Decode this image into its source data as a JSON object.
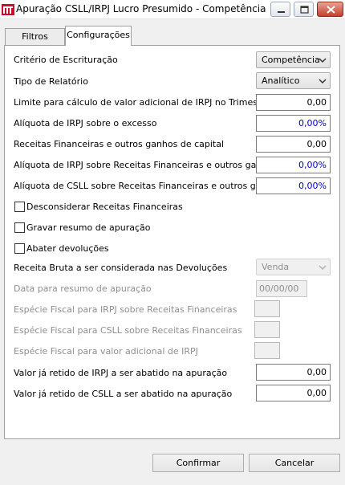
{
  "window": {
    "title": "Apuração CSLL/IRPJ Lucro Presumido - Competência",
    "icon": "app-logo-icon"
  },
  "tabs": [
    {
      "label": "Filtros",
      "active": false
    },
    {
      "label": "Configurações",
      "active": true
    }
  ],
  "form": {
    "criterio_label": "Critério de Escrituração",
    "criterio_value": "Competência",
    "tipo_label": "Tipo de Relatório",
    "tipo_value": "Analítico",
    "limite_label": "Limite para cálculo de valor adicional de IRPJ no Trimestre",
    "limite_value": "0,00",
    "aliq_irpj_label": "Alíquota de IRPJ sobre o excesso",
    "aliq_irpj_value": "0,00%",
    "receitas_label": "Receitas Financeiras e outros ganhos de capital",
    "receitas_value": "0,00",
    "aliq_irpj_rf_label": "Alíquota de IRPJ sobre Receitas Financeiras e outros ganhos",
    "aliq_irpj_rf_value": "0,00%",
    "aliq_csll_rf_label": "Alíquota de CSLL sobre Receitas Financeiras e outros ganhos",
    "aliq_csll_rf_value": "0,00%",
    "desconsiderar_label": "Desconsiderar Receitas Financeiras",
    "gravar_label": "Gravar resumo de apuração",
    "abater_label": "Abater devoluções",
    "receita_bruta_label": "Receita Bruta a ser considerada nas Devoluções",
    "receita_bruta_value": "Venda",
    "data_resumo_label": "Data para resumo de apuração",
    "data_resumo_value": "00/00/00",
    "especie_irpj_label": "Espécie Fiscal para IRPJ sobre Receitas Financeiras",
    "especie_csll_label": "Espécie Fiscal para CSLL sobre Receitas Financeiras",
    "especie_adic_label": "Espécie Fiscal para valor adicional de IRPJ",
    "irpj_retido_label": "Valor já retido de IRPJ a ser abatido na apuração",
    "irpj_retido_value": "0,00",
    "csll_retido_label": "Valor já retido de CSLL a ser abatido na apuração",
    "csll_retido_value": "0,00"
  },
  "buttons": {
    "confirm": "Confirmar",
    "cancel": "Cancelar"
  },
  "colors": {
    "percent_text": "#0000c8",
    "close_button": "#c2412c"
  }
}
